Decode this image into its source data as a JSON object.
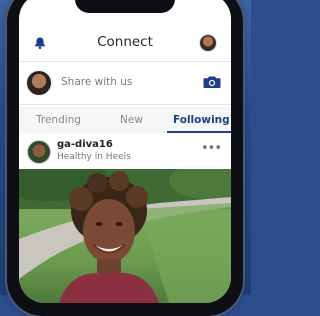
{
  "header": {
    "title": "Connect",
    "bell_icon": "bell-icon",
    "profile_icon": "profile-avatar"
  },
  "share": {
    "placeholder": "Share with us",
    "camera_icon": "camera-icon"
  },
  "tabs": [
    {
      "label": "Trending",
      "active": false
    },
    {
      "label": "New",
      "active": false
    },
    {
      "label": "Following",
      "active": true
    }
  ],
  "post": {
    "username": "ga-diva16",
    "subtitle": "Healthy in Heels",
    "more_icon": "more-options-icon",
    "more_label": "•••"
  },
  "colors": {
    "accent": "#1d3f8a",
    "background": "#2c4e8c"
  }
}
